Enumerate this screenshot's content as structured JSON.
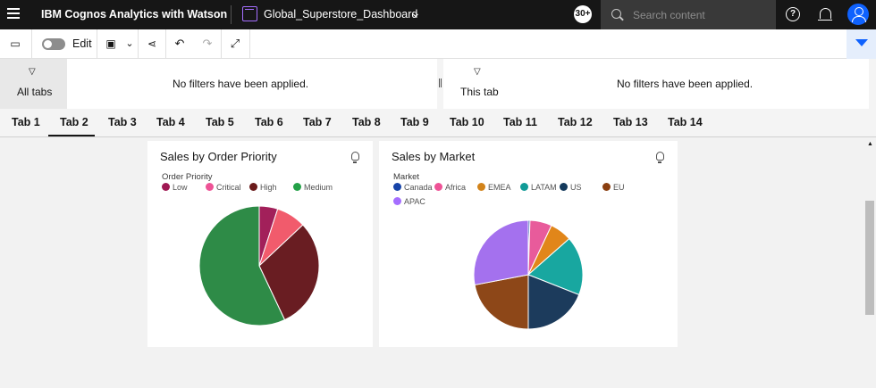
{
  "header": {
    "app_title": "IBM Cognos Analytics with Watson",
    "dashboard_name": "Global_Superstore_Dashboard",
    "notification_count": "30+",
    "search_placeholder": "Search content"
  },
  "toolbar": {
    "edit_label": "Edit",
    "edit_mode_on": false
  },
  "filters": {
    "all_tabs_label": "All tabs",
    "all_tabs_message": "No filters have been applied.",
    "this_tab_label": "This tab",
    "this_tab_message": "No filters have been applied."
  },
  "tabs": [
    {
      "label": "Tab 1"
    },
    {
      "label": "Tab 2",
      "active": true
    },
    {
      "label": "Tab 3"
    },
    {
      "label": "Tab 4"
    },
    {
      "label": "Tab 5"
    },
    {
      "label": "Tab 6"
    },
    {
      "label": "Tab 7"
    },
    {
      "label": "Tab 8"
    },
    {
      "label": "Tab 9"
    },
    {
      "label": "Tab 10"
    },
    {
      "label": "Tab 11"
    },
    {
      "label": "Tab 12"
    },
    {
      "label": "Tab 13"
    },
    {
      "label": "Tab 14"
    }
  ],
  "colors": {
    "accent": "#0f62fe",
    "header_bg": "#161616"
  },
  "chart_data": [
    {
      "type": "pie",
      "title": "Sales by Order Priority",
      "legend_title": "Order Priority",
      "legend_placement": "top-left",
      "categories": [
        "Low",
        "Critical",
        "High",
        "Medium"
      ],
      "values": [
        5,
        8,
        30,
        57
      ],
      "colors": [
        "#9f1853",
        "#ee5396",
        "#6a1a1a",
        "#24a148"
      ],
      "slice_colors": [
        "#a2205a",
        "#f15b6c",
        "#691d22",
        "#2e8b47"
      ]
    },
    {
      "type": "pie",
      "title": "Sales by Market",
      "legend_title": "Market",
      "legend_placement": "top-left",
      "categories": [
        "Canada",
        "Africa",
        "EMEA",
        "LATAM",
        "US",
        "EU",
        "APAC"
      ],
      "values": [
        0.5,
        6.5,
        6.5,
        17.5,
        19,
        22,
        28
      ],
      "colors": [
        "#1744a8",
        "#ee5396",
        "#d2831a",
        "#119b97",
        "#143a5c",
        "#8a3f10",
        "#a56eff"
      ],
      "slice_colors": [
        "#1744a8",
        "#e85b9b",
        "#e1861a",
        "#18a7a0",
        "#1c3b5c",
        "#8d4718",
        "#a471ee"
      ]
    }
  ]
}
